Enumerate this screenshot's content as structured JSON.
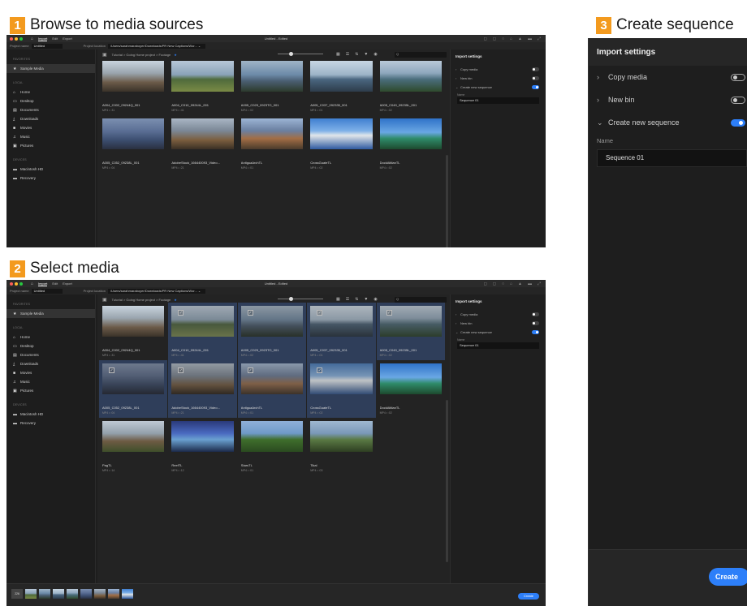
{
  "steps": [
    {
      "num": "1",
      "title": "Browse to media sources"
    },
    {
      "num": "2",
      "title": "Select media"
    },
    {
      "num": "3",
      "title": "Create sequence"
    }
  ],
  "app": {
    "tabs": [
      "Import",
      "Edit",
      "Export"
    ],
    "window_title": "Untitled - Edited",
    "project_name_label": "Project name",
    "project_name": "Untitled",
    "project_location_label": "Project location",
    "project_location": "/Users/sarahmaraboyer/Downloads/PR New Captions/Wor..."
  },
  "sidebar": {
    "favorites_label": "FAVORITES",
    "favorites": [
      {
        "label": "Sample Media",
        "icon": "star-icon"
      }
    ],
    "local_label": "LOCAL",
    "local": [
      {
        "label": "Home",
        "icon": "home-icon"
      },
      {
        "label": "Desktop",
        "icon": "desktop-icon"
      },
      {
        "label": "Documents",
        "icon": "document-icon"
      },
      {
        "label": "Downloads",
        "icon": "download-icon"
      },
      {
        "label": "Movies",
        "icon": "movie-icon"
      },
      {
        "label": "Music",
        "icon": "music-icon"
      },
      {
        "label": "Pictures",
        "icon": "pictures-icon"
      }
    ],
    "devices_label": "DEVICES",
    "devices": [
      {
        "label": "Macintosh HD",
        "icon": "drive-icon"
      },
      {
        "label": "Recovery",
        "icon": "drive-icon"
      }
    ]
  },
  "breadcrumb": "Tutorial  >  Going Home project  >  Footage",
  "search_placeholder": "Q",
  "media": [
    {
      "name": "A004_C002_09244Q_001",
      "meta": "MP4 • :31"
    },
    {
      "name": "A004_C010_09244L_001",
      "meta": "MP4 • :41"
    },
    {
      "name": "A005_C029_0923TO_001",
      "meta": "MP4 • :02"
    },
    {
      "name": "A005_C037_092335_001",
      "meta": "MP4 • :01"
    },
    {
      "name": "A005_C049_09235L_001",
      "meta": "MP4 • :02"
    },
    {
      "name": "A005_C052_09238L_001",
      "meta": "MP4 • :04"
    },
    {
      "name": "AdobeStock_166440093_Video...",
      "meta": "MP4 • :21"
    },
    {
      "name": "AntiguaArchTL",
      "meta": "MP4 • :01"
    },
    {
      "name": "CrossGuateTL",
      "meta": "MP4 • :02"
    },
    {
      "name": "DockAtitlanTL",
      "meta": "MP4 • :02"
    },
    {
      "name": "PagTL",
      "meta": "MP4 • :14"
    },
    {
      "name": "ReefTL",
      "meta": "MP4 • :12"
    },
    {
      "name": "StarsTL",
      "meta": "MP4 • :01"
    },
    {
      "name": "Tikal",
      "meta": "MP4 • :03"
    }
  ],
  "import_settings": {
    "title": "Import settings",
    "copy_media": "Copy media",
    "new_bin": "New bin",
    "create_new_sequence": "Create new sequence",
    "name_label": "Name",
    "name_value": "Sequence 01"
  },
  "bottom": {
    "count": "226",
    "create": "Create"
  }
}
